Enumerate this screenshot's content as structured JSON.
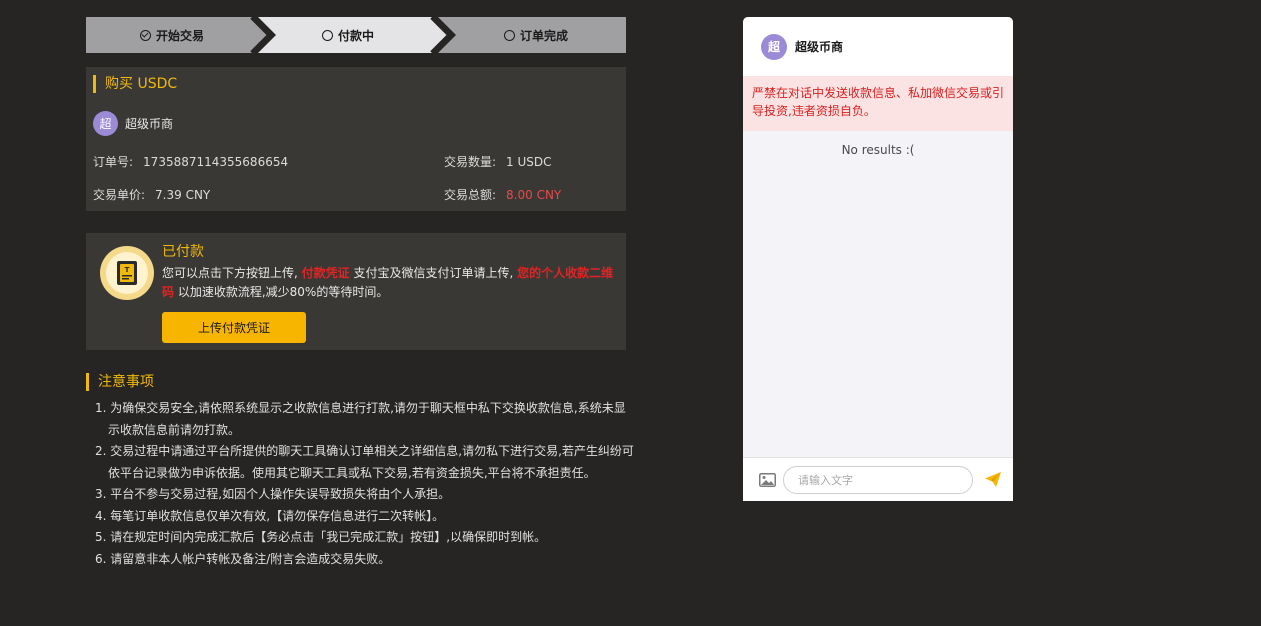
{
  "stepper": {
    "steps": [
      {
        "label": "开始交易",
        "state": "done"
      },
      {
        "label": "付款中",
        "state": "active"
      },
      {
        "label": "订单完成",
        "state": "pending"
      }
    ],
    "colors": {
      "done": "#a0a0a3",
      "active": "#e4e4e6",
      "pending": "#a0a0a3"
    }
  },
  "order": {
    "title": "购买 USDC",
    "merchant_avatar": "超",
    "merchant_name": "超级币商",
    "order_no_label": "订单号:",
    "order_no": "1735887114355686654",
    "quantity_label": "交易数量:",
    "quantity": "1 USDC",
    "unit_price_label": "交易单价:",
    "unit_price": "7.39 CNY",
    "total_label": "交易总额:",
    "total": "8.00 CNY"
  },
  "paid": {
    "icon": "receipt-icon",
    "title": "已付款",
    "desc_1": "您可以点击下方按钮上传,",
    "desc_hl_1": "付款凭证",
    "desc_2": "支付宝及微信支付订单请上传,",
    "desc_hl_2": "您的个人收款二维码",
    "desc_3": "以加速收款流程,减少80%的等待时间。",
    "upload_button": "上传付款凭证"
  },
  "notes": {
    "title": "注意事项",
    "items": [
      "1. 为确保交易安全,请依照系统显示之收款信息进行打款,请勿于聊天框中私下交换收款信息,系统未显示收款信息前请勿打款。",
      "2. 交易过程中请通过平台所提供的聊天工具确认订单相关之详细信息,请勿私下进行交易,若产生纠纷可依平台记录做为申诉依据。使用其它聊天工具或私下交易,若有资金损失,平台将不承担责任。",
      "3. 平台不参与交易过程,如因个人操作失误导致损失将由个人承担。",
      "4. 每笔订单收款信息仅单次有效,【请勿保存信息进行二次转帐】。",
      "5. 请在规定时间内完成汇款后【务必点击「我已完成汇款」按钮】,以确保即时到帐。",
      "6. 请留意非本人帐户转帐及备注/附言会造成交易失败。"
    ]
  },
  "chat": {
    "avatar": "超",
    "name": "超级币商",
    "warning": "严禁在对话中发送收款信息、私加微信交易或引导投资,违者资损自负。",
    "empty_text": "No results :(",
    "input_placeholder": "请输入文字",
    "image_icon": "image-icon",
    "send_icon": "send-icon"
  }
}
